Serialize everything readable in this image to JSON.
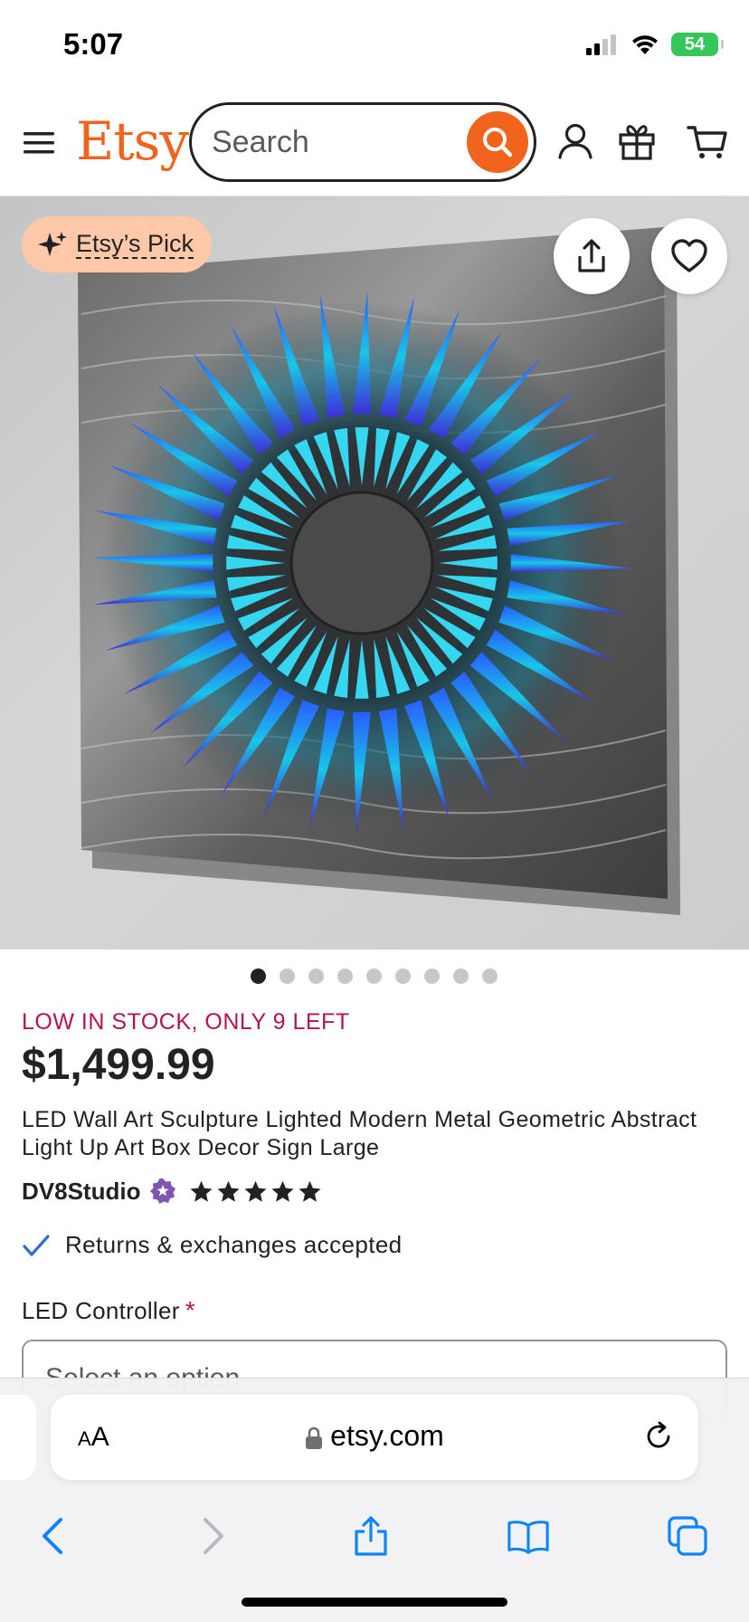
{
  "status_bar": {
    "time": "5:07",
    "battery": "54"
  },
  "header": {
    "logo": "Etsy",
    "search_placeholder": "Search"
  },
  "hero": {
    "badge_label": "Etsy’s Pick",
    "image_count": 9,
    "active_index": 0
  },
  "product": {
    "stock_notice": "LOW IN STOCK, ONLY 9 LEFT",
    "price": "$1,499.99",
    "title": "LED Wall Art Sculpture Lighted Modern Metal Geometric Abstract Light Up Art Box Decor Sign Large",
    "shop_name": "DV8Studio",
    "rating": 5,
    "returns": "Returns & exchanges accepted",
    "option_label": "LED Controller",
    "option_required_mark": "*",
    "option_value": "Select an option"
  },
  "browser": {
    "text_size_label": "AA",
    "url": "etsy.com"
  },
  "colors": {
    "etsy_orange": "#f1641e",
    "stock_red": "#b3154e",
    "badge_peach": "#ffc8a8",
    "ios_blue": "#0a84ff",
    "check_blue": "#2f6fd1",
    "star_seller_purple": "#7f55b1"
  },
  "icons": {
    "menu": "menu-icon",
    "search": "search-icon",
    "account": "account-icon",
    "gift": "gift-icon",
    "cart": "cart-icon",
    "sparkle": "sparkle-icon",
    "share": "share-icon",
    "heart": "heart-icon",
    "check": "check-icon",
    "star_seller": "star-seller-icon",
    "lock": "lock-icon",
    "reload": "reload-icon",
    "back": "back-icon",
    "forward": "forward-icon",
    "bookmarks": "bookmarks-icon",
    "tabs": "tabs-icon"
  }
}
